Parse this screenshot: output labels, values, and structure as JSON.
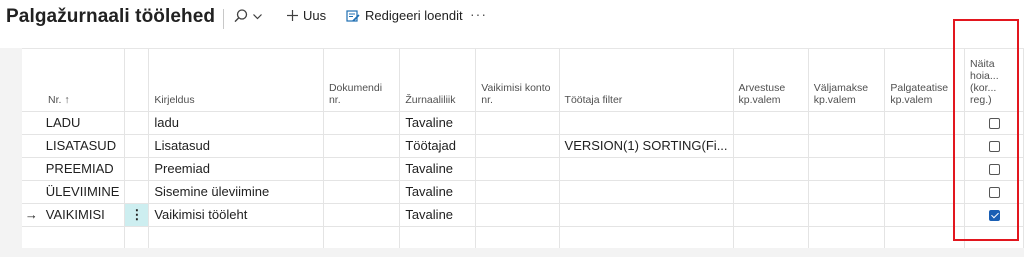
{
  "header": {
    "title": "Palgažurnaali töölehed",
    "new_label": "Uus",
    "edit_list_label": "Redigeeri loendit",
    "more_label": "···"
  },
  "icons": {
    "search": "search-icon",
    "new": "plus-icon",
    "edit_list": "edit-list-icon",
    "sort": "arrow-up-icon",
    "row_pointer": "arrow-right-icon"
  },
  "colors": {
    "accent": "#1a5fb4",
    "selected_cell": "#cdeef0",
    "highlight_box": "#e2161e"
  },
  "columns": {
    "nr": "Nr.",
    "nr_sort_indicator": "↑",
    "description": "Kirjeldus",
    "doc_nr": "Dokumendi nr.",
    "journal_type": "Žurnaaliliik",
    "default_account": "Vaikimisi konto nr.",
    "employee_filter": "Töötaja filter",
    "calc_formula": "Arvestuse kp.valem",
    "payout_formula": "Väljamakse kp.valem",
    "payslip_formula": "Palgateatise kp.valem",
    "show_hold": "Näita hoia... (kor... reg.)"
  },
  "rows": [
    {
      "nr": "LADU",
      "description": "ladu",
      "doc_nr": "",
      "journal_type": "Tavaline",
      "default_account": "",
      "employee_filter": "",
      "calc_formula": "",
      "payout_formula": "",
      "payslip_formula": "",
      "show_hold": false
    },
    {
      "nr": "LISATASUD",
      "description": "Lisatasud",
      "doc_nr": "",
      "journal_type": "Töötajad",
      "default_account": "",
      "employee_filter": "VERSION(1) SORTING(Fi...",
      "calc_formula": "",
      "payout_formula": "",
      "payslip_formula": "",
      "show_hold": false
    },
    {
      "nr": "PREEMIAD",
      "description": "Preemiad",
      "doc_nr": "",
      "journal_type": "Tavaline",
      "default_account": "",
      "employee_filter": "",
      "calc_formula": "",
      "payout_formula": "",
      "payslip_formula": "",
      "show_hold": false
    },
    {
      "nr": "ÜLEVIIMINE",
      "description": "Sisemine üleviimine",
      "doc_nr": "",
      "journal_type": "Tavaline",
      "default_account": "",
      "employee_filter": "",
      "calc_formula": "",
      "payout_formula": "",
      "payslip_formula": "",
      "show_hold": false
    },
    {
      "nr": "VAIKIMISI",
      "description": "Vaikimisi tööleht",
      "doc_nr": "",
      "journal_type": "Tavaline",
      "default_account": "",
      "employee_filter": "",
      "calc_formula": "",
      "payout_formula": "",
      "payslip_formula": "",
      "show_hold": true,
      "current": true
    }
  ],
  "row_actions_glyph": "⋮",
  "row_pointer_glyph": "→"
}
